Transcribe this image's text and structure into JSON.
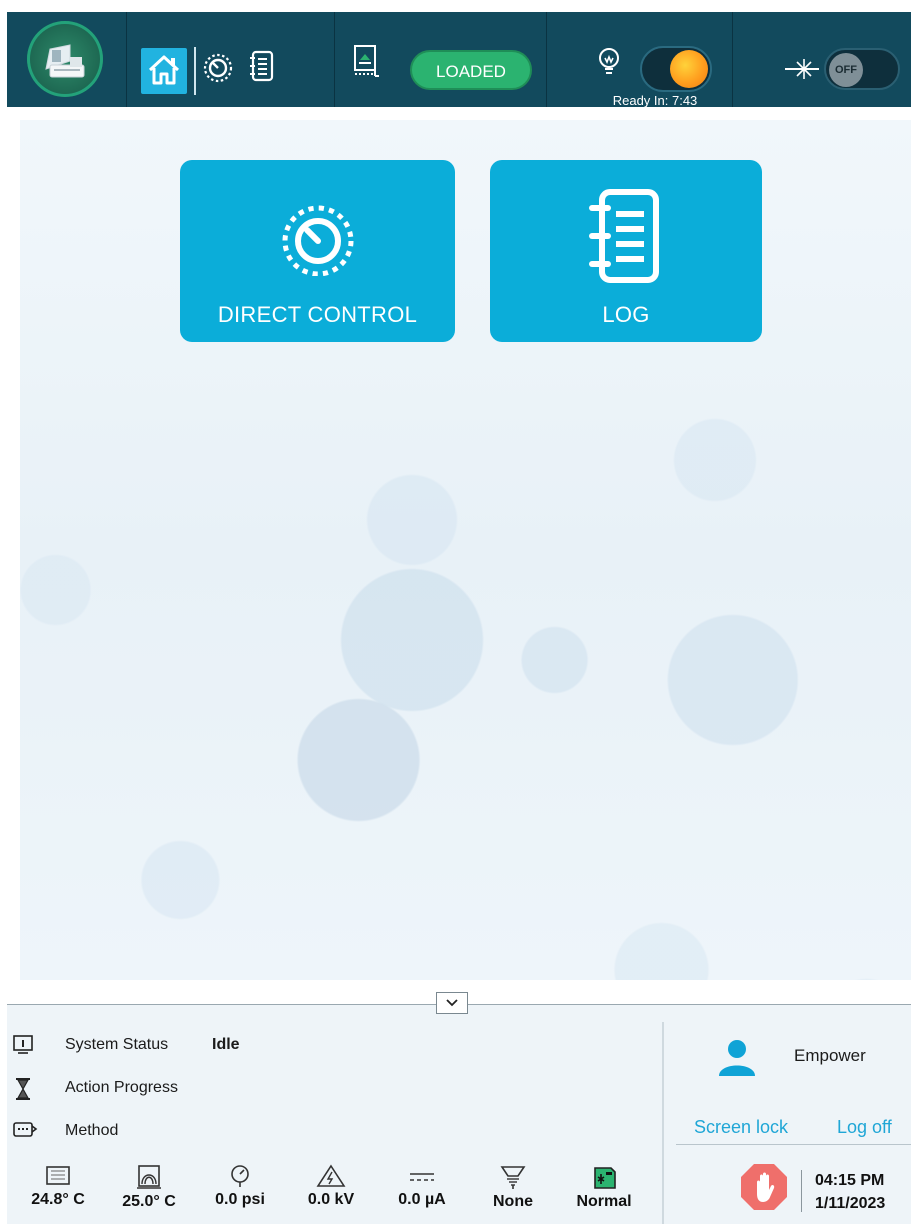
{
  "topbar": {
    "loaded_label": "LOADED",
    "ready_text": "Ready In: 7:43",
    "laser_state": "OFF",
    "icons": [
      "instrument-logo-icon",
      "home-icon",
      "direct-control-icon",
      "log-icon",
      "tray-icon",
      "lamp-icon",
      "laser-icon"
    ]
  },
  "tiles": {
    "direct_control": "DIRECT CONTROL",
    "log": "LOG"
  },
  "status": {
    "system_status_label": "System Status",
    "system_status_value": "Idle",
    "action_progress_label": "Action Progress",
    "method_label": "Method"
  },
  "metrics": [
    {
      "icon": "tray-temperature-icon",
      "value": "24.8° C"
    },
    {
      "icon": "capillary-temperature-icon",
      "value": "25.0° C"
    },
    {
      "icon": "pressure-icon",
      "value": "0.0 psi"
    },
    {
      "icon": "voltage-icon",
      "value": "0.0 kV"
    },
    {
      "icon": "current-icon",
      "value": "0.0 µA"
    },
    {
      "icon": "detector-icon",
      "value": "None"
    },
    {
      "icon": "mode-icon",
      "value": "Normal"
    }
  ],
  "user": {
    "name": "Empower",
    "screen_lock": "Screen lock",
    "log_off": "Log off"
  },
  "clock": {
    "time": "04:15 PM",
    "date": "1/11/2023"
  },
  "colors": {
    "topbar": "#124a5d",
    "tile": "#0badd9",
    "loaded": "#2bb370",
    "link": "#1fa6d6",
    "stop": "#ef6f6b"
  }
}
